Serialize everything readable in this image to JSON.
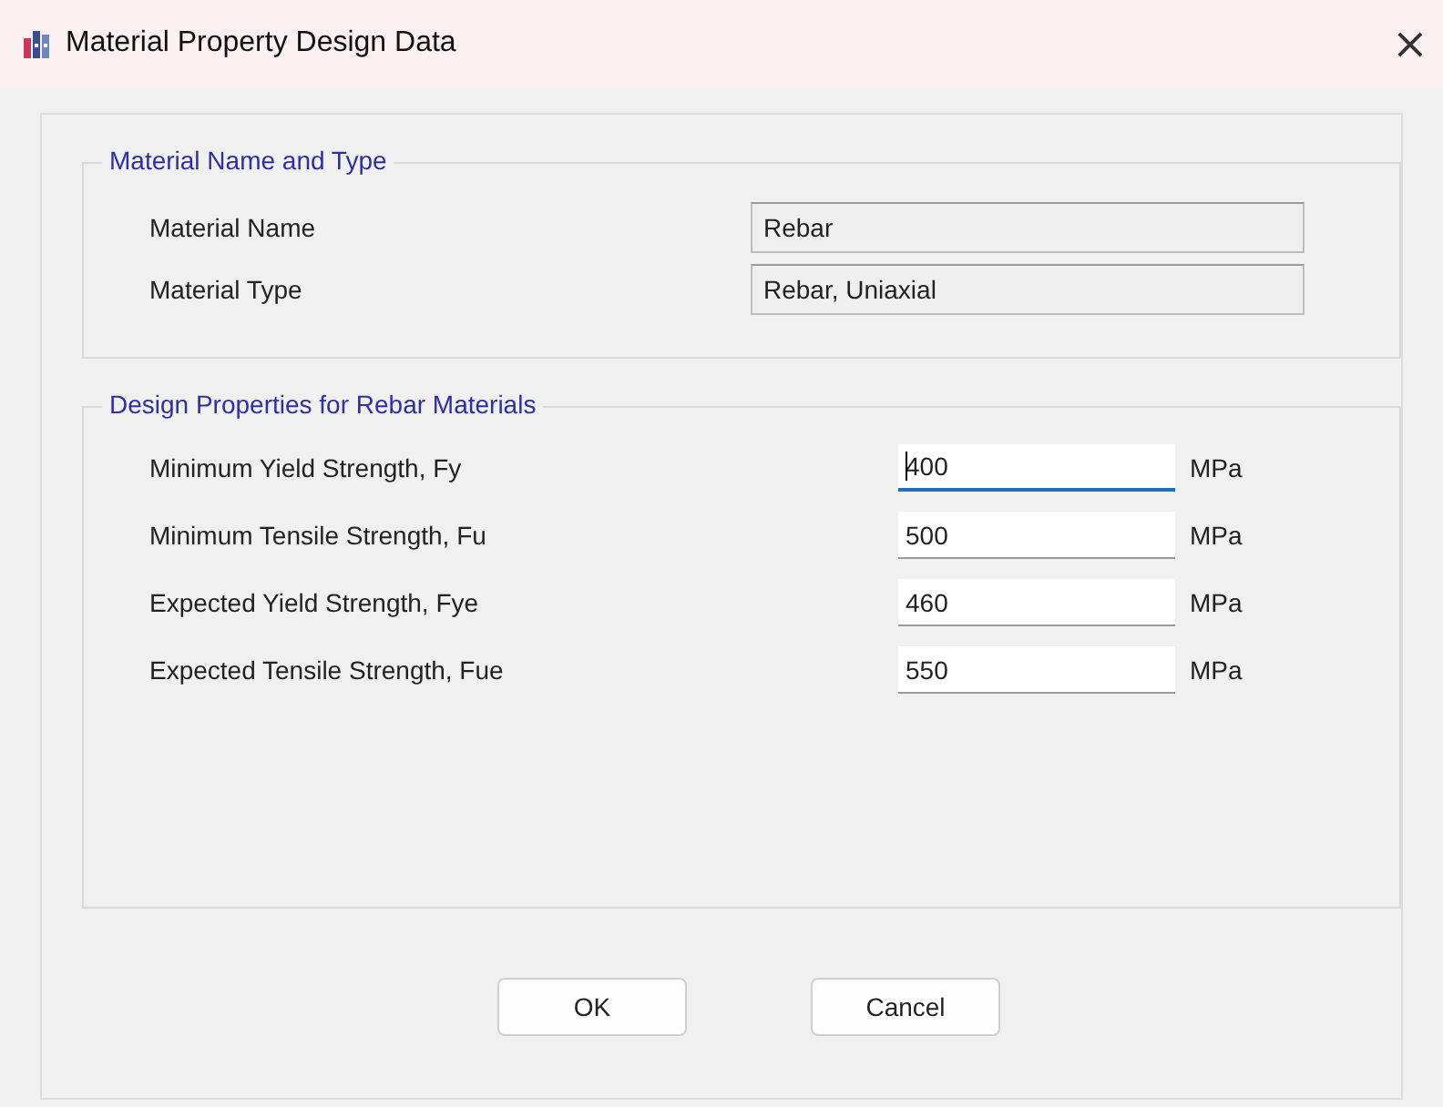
{
  "window": {
    "title": "Material Property Design Data",
    "close": "×"
  },
  "material_group": {
    "title": "Material Name and Type",
    "fields": [
      {
        "label": "Material Name",
        "value": "Rebar"
      },
      {
        "label": "Material Type",
        "value": "Rebar, Uniaxial"
      }
    ]
  },
  "design_group": {
    "title": "Design Properties for Rebar Materials",
    "fields": [
      {
        "label": "Minimum Yield Strength, Fy",
        "value": "400",
        "unit": "MPa",
        "focused": true
      },
      {
        "label": "Minimum Tensile Strength, Fu",
        "value": "500",
        "unit": "MPa",
        "focused": false
      },
      {
        "label": "Expected Yield Strength, Fye",
        "value": "460",
        "unit": "MPa",
        "focused": false
      },
      {
        "label": "Expected Tensile Strength, Fue",
        "value": "550",
        "unit": "MPa",
        "focused": false
      }
    ]
  },
  "buttons": [
    "OK",
    "Cancel"
  ]
}
